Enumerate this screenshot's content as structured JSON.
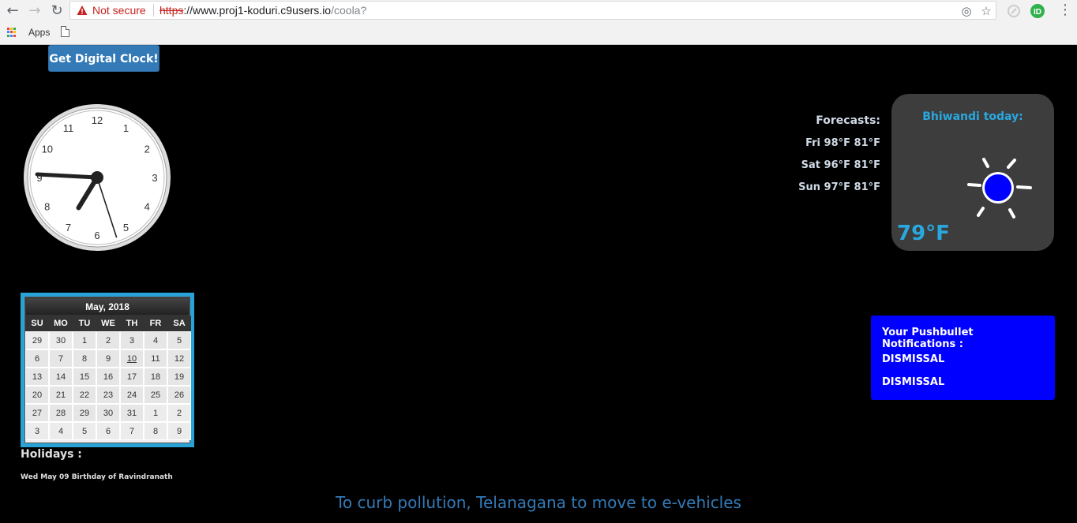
{
  "browser": {
    "security_label": "Not secure",
    "url_scheme": "https",
    "url_host": "://www.proj1-koduri.c9users.io",
    "url_path": "/coola?",
    "bookmarks_apps_label": "Apps"
  },
  "page": {
    "digital_clock_button": "Get Digital Clock!",
    "clock": {
      "numbers": [
        "12",
        "1",
        "2",
        "3",
        "4",
        "5",
        "6",
        "7",
        "8",
        "9",
        "10",
        "11"
      ],
      "hour": 7.05,
      "minute": 45.5,
      "second": 27
    },
    "forecasts": {
      "title": "Forecasts:",
      "rows": [
        "Fri 98°F 81°F",
        "Sat 96°F 81°F",
        "Sun 97°F 81°F"
      ]
    },
    "weather": {
      "city": "Bhiwandi today:",
      "temperature": "79°F",
      "icon": "sun-icon",
      "accent": "#29a8e0",
      "sun_color": "#0000ff"
    },
    "calendar": {
      "title": "May, 2018",
      "days": [
        "SU",
        "MO",
        "TU",
        "WE",
        "TH",
        "FR",
        "SA"
      ],
      "weeks": [
        [
          "29",
          "30",
          "1",
          "2",
          "3",
          "4",
          "5"
        ],
        [
          "6",
          "7",
          "8",
          "9",
          "10",
          "11",
          "12"
        ],
        [
          "13",
          "14",
          "15",
          "16",
          "17",
          "18",
          "19"
        ],
        [
          "20",
          "21",
          "22",
          "23",
          "24",
          "25",
          "26"
        ],
        [
          "27",
          "28",
          "29",
          "30",
          "31",
          "1",
          "2"
        ],
        [
          "3",
          "4",
          "5",
          "6",
          "7",
          "8",
          "9"
        ]
      ],
      "today": "10",
      "border_color": "#29a3d6"
    },
    "holidays": {
      "title": "Holidays :",
      "items": [
        "Wed May 09 Birthday of Ravindranath"
      ]
    },
    "pushbullet": {
      "title": "Your Pushbullet Notifications :",
      "items": [
        "DISMISSAL",
        "DISMISSAL"
      ],
      "color": "#0000ff"
    },
    "news": "To curb pollution, Telanagana to move to e-vehicles"
  }
}
